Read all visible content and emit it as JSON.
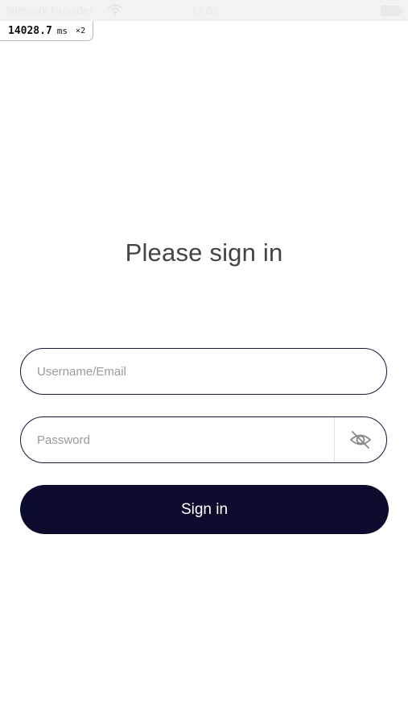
{
  "status_bar": {
    "carrier": "Network Provider",
    "time": "17:51",
    "wifi_icon": "wifi-icon",
    "battery_icon": "battery-icon"
  },
  "perf_overlay": {
    "value": "14028.7",
    "unit": "ms",
    "multiplier": "×2"
  },
  "login": {
    "title": "Please sign in",
    "username_placeholder": "Username/Email",
    "username_value": "",
    "password_placeholder": "Password",
    "password_value": "",
    "visibility_icon": "eye-off-icon",
    "submit_label": "Sign in"
  },
  "colors": {
    "primary": "#0b0c2e",
    "field_border": "#15163a",
    "title_text": "#444444",
    "placeholder": "#9a9a9a"
  }
}
